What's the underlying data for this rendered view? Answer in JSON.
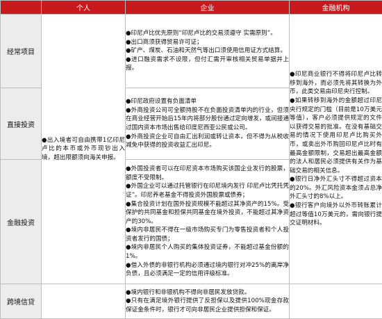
{
  "header": {
    "c0": "",
    "c1": "个人",
    "c2": "企业",
    "c3": "金融机构"
  },
  "rows": [
    {
      "label": "经常项目",
      "enterprise": [
        "●印尼卢比优先原则“印尼卢比的交易须遵守 实需原则”。",
        "●出口商须获得贸易许可证；",
        "●矿产、煤炭、石油和天然气等出口须使用信用证方式结算。",
        "●进口融资需求不设限，但付汇需开审核相关贸易单据并上报。"
      ]
    },
    {
      "label": "直接投资",
      "enterprise": [
        "●印尼政府设置有负面清单",
        "●外商投资公司可全额持股不在负面投资清单内的行业，但须在商业经营开始后15年内将部分股份通过定向增发，或间接通过国内资本市场出售给印度尼西亚公民或公司。",
        "●外商投资企业可自由汇出利润或转让资本，但不得为从税收减免中获得的投资收益汇出印尼。"
      ]
    },
    {
      "label": "金融投资",
      "enterprise": [
        "●外国投资者可以在印尼资本市场购买该国企业发行的股票，额度不受限制。",
        "●外国企业可以通过托管银行在印尼境内发行 印尼卢比凭托凭证”。印尼养老基金不得投资外国股票或债券；",
        "●集合投资计划在国外投资规模不能超过其净资产的15%。受保护的共同基金和担保共同基金在境外投资，不能超过其净资产的30%。",
        "●境内非居民不得在一级市场购买专门为零售投资者和个人投资者发行的国债；",
        "●境内非居民个人购买的集体投资证券，不能超过基金份额的1%。",
        "●借入外债的非银行机构必须通过境内银行对冲25%的离岸净负债，且必须满足一定的信用评级标准。"
      ]
    },
    {
      "label": "跨境信贷",
      "enterprise": [
        "●境内银行和非银机构不得向非居民发放贷款。",
        "●只有在满足境外银行提供了反担保以及提供100%现金存款保证金条件时，银行才可向非居民企业提供担保和保证。"
      ]
    }
  ],
  "individual": [
    "●出入境者可自由携带1亿印尼卢比的本币或外币现钞出入境，超出限额须向海关申报。"
  ],
  "financial": [
    "●印尼商业银行不得将印尼卢比转移到海外，而必须先将其转换为外币，此类交易由印尼央行控制。",
    "●如果转移到海外的金额超过印尼央行规定的门槛（目前是10万美元等值），客户必须提供规定的文件以获得交易的批准。在没有基础交易的情况下使用印尼卢比购买外币，或卖出外币购回印尼卢比时有最高金额限制，交易超出最高金额的法人和居民必须提供有关作为基础交易的相关信息。",
    "●银行日净外汇头寸不得超过资本的20%。外汇风险资本金须占总净外汇头寸的8%以上。",
    "●银行客户向境外以外币转账累计超过等值10万美元的，需向银行提交证明材料。"
  ]
}
